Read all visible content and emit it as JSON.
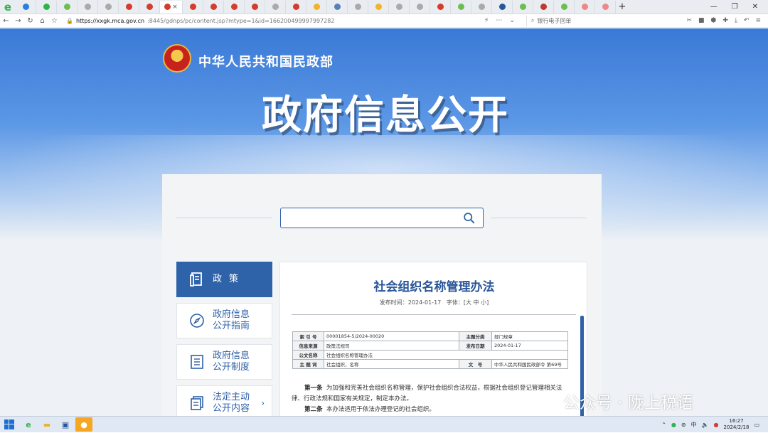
{
  "browser": {
    "url_host": "https://xxgk.mca.gov.cn",
    "url_rest": ":8445/gdnps/pc/content.jsp?mtype=1&id=166200499997997282",
    "search_text": "银行电子回单",
    "active_tab_close": "×",
    "new_tab": "+"
  },
  "header": {
    "ministry_name": "中华人民共和国民政部",
    "hero_title": "政府信息公开"
  },
  "search": {
    "placeholder": ""
  },
  "sidebar": {
    "items": [
      {
        "label": "政策"
      },
      {
        "label": "政府信息公开指南"
      },
      {
        "label": "政府信息公开制度"
      },
      {
        "label": "法定主动公开内容"
      }
    ],
    "arrow": "›"
  },
  "document": {
    "title": "社会组织名称管理办法",
    "publish_label": "发布时间：",
    "publish_date": "2024-01-17",
    "font_label": "字体：[大 中 小]",
    "meta": {
      "index_label": "索 引 号",
      "index_value": "00001854-5/2024-00020",
      "category_label": "主题分类",
      "category_value": "部门规章",
      "source_label": "信息来源",
      "source_value": "政策法规司",
      "date_label": "发布日期",
      "date_value": "2024-01-17",
      "name_label": "公文名称",
      "name_value": "社会组织名称管理办法",
      "keyword_label": "主 题 词",
      "keyword_value": "社会组织，名称",
      "docno_label": "文　号",
      "docno_value": "中华人民共和国民政部令 第69号"
    },
    "articles": [
      {
        "num": "第一条",
        "text": "为加强和完善社会组织名称管理，保护社会组织合法权益，根据社会组织登记管理相关法律、行政法规和国家有关规定，制定本办法。"
      },
      {
        "num": "第二条",
        "text": "本办法适用于依法办理登记的社会组织。"
      }
    ]
  },
  "watermark": {
    "text": "公众号 · 陇上税语"
  },
  "taskbar": {
    "time": "16:27",
    "date": "2024/2/18",
    "ime": "中"
  },
  "colors": {
    "accent": "#2f63a9",
    "title_blue": "#2a5599"
  }
}
